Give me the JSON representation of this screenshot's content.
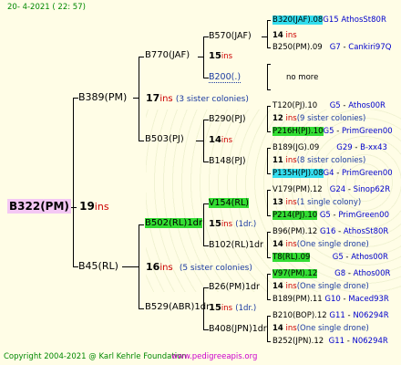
{
  "header": {
    "date": "20-  4-2021 ( 22: 57)"
  },
  "footer": {
    "copyright": "Copyright 2004-2021 @ Karl Kehrle Foundation",
    "site": "www.pedigreeapis.org"
  },
  "colors": {
    "background": "#fffde6",
    "root_highlight": "#f4c8f4",
    "green_highlight": "#33dd33",
    "cyan_highlight": "#33ddee",
    "ins_red": "#cc0000",
    "date_green": "#008800",
    "footer_magenta": "#cc00cc"
  },
  "root": {
    "id": "B322(PM)",
    "num": "19",
    "ins": "ins"
  },
  "g2": {
    "top": {
      "id": "B389(PM)",
      "num": "17",
      "ins": "ins",
      "note": "(3 sister colonies)"
    },
    "bottom": {
      "id": "B45(RL)",
      "num": "16",
      "ins": "ins",
      "note": "(5 sister colonies)"
    }
  },
  "g3": {
    "a": {
      "id": "B770(JAF)",
      "num": "15",
      "ins": "ins"
    },
    "b": {
      "id": "B503(PJ)",
      "num": "14",
      "ins": "ins"
    },
    "c": {
      "id": "B502(RL)1dr",
      "num": "15",
      "ins": "ins",
      "note": "(1dr.)"
    },
    "d": {
      "id": "B529(ABR)1dr",
      "num": "15",
      "ins": "ins",
      "note": "(1dr.)"
    }
  },
  "g4": {
    "a1": {
      "id": "B570(JAF)",
      "num": "14",
      "ins": "ins"
    },
    "a2": {
      "id": "B200(.)"
    },
    "b1": {
      "id": "B290(PJ)",
      "num": "14",
      "ins": "ins"
    },
    "b2": {
      "id": "B148(PJ)",
      "num": "11",
      "ins": "ins"
    },
    "c1": {
      "id": "V154(RL)"
    },
    "c2": {
      "id": "B102(RL)1dr",
      "num": "14",
      "ins": "ins"
    },
    "d1": {
      "id": "B26(PM)1dr"
    },
    "d2": {
      "id": "B408(JPN)1dr",
      "num": "14",
      "ins": "ins"
    }
  },
  "g5": [
    {
      "id": "B320(JAF).08",
      "gen": "G15",
      "loc": "AthosSt80R"
    },
    {
      "num": "14",
      "ins": "ins"
    },
    {
      "id": "B250(PM).09",
      "gen": "G7",
      "loc": "Cankiri97Q"
    },
    {
      "id": "no more"
    },
    {
      "id": "T120(PJ).10",
      "gen": "G5",
      "loc": "Athos00R"
    },
    {
      "num": "12",
      "ins": "ins",
      "note": "(9 sister colonies)"
    },
    {
      "id": "P216H(PJ).10",
      "gen": "G5",
      "loc": "PrimGreen00"
    },
    {
      "id": "B189(JG).09",
      "gen": "G29",
      "loc": "B-xx43"
    },
    {
      "num": "11",
      "ins": "ins",
      "note": "(8 sister colonies)"
    },
    {
      "id": "P135H(PJ).08",
      "gen": "G4",
      "loc": "PrimGreen00"
    },
    {
      "id": "V179(PM).12",
      "gen": "G24",
      "loc": "Sinop62R"
    },
    {
      "num": "13",
      "ins": "ins",
      "note": "(1 single colony)"
    },
    {
      "id": "P214(PJ).10",
      "gen": "G5",
      "loc": "PrimGreen00"
    },
    {
      "id": "B96(PM).12",
      "gen": "G16",
      "loc": "AthosSt80R"
    },
    {
      "num": "14",
      "ins": "ins",
      "note": "(One single drone)"
    },
    {
      "id": "T8(RL).09",
      "gen": "G5",
      "loc": "Athos00R"
    },
    {
      "id": "V97(PM).12",
      "gen": "G8",
      "loc": "Athos00R"
    },
    {
      "num": "14",
      "ins": "ins",
      "note": "(One single drone)"
    },
    {
      "id": "B189(PM).11",
      "gen": "G10",
      "loc": "Maced93R"
    },
    {
      "id": "B210(BOP).12",
      "gen": "G11",
      "loc": "N06294R"
    },
    {
      "num": "14",
      "ins": "ins",
      "note": "(One single drone)"
    },
    {
      "id": "B252(JPN).12",
      "gen": "G11",
      "loc": "N06294R"
    }
  ]
}
